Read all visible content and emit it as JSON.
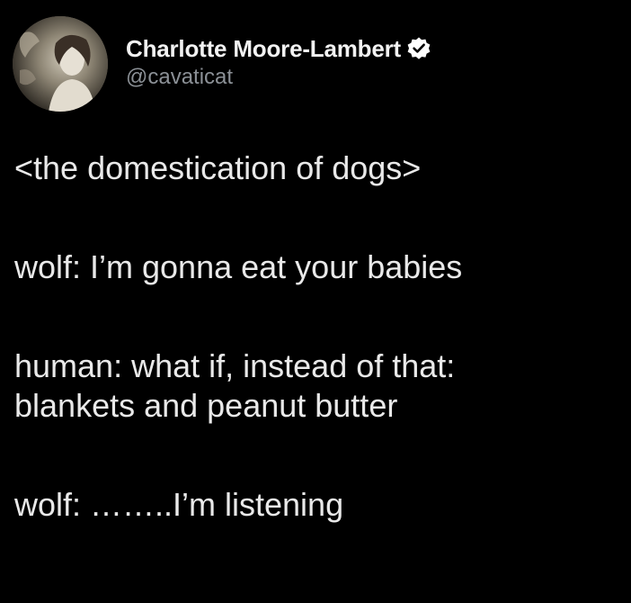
{
  "tweet": {
    "author": {
      "display_name": "Charlotte Moore-Lambert",
      "handle": "@cavaticat",
      "verified": true,
      "avatar_icon": "profile-avatar"
    },
    "lines": [
      "<the domestication of dogs>",
      "wolf: I’m gonna eat your babies",
      "human: what if, instead of that:",
      "blankets and peanut butter",
      "wolf: ……..I’m listening"
    ]
  },
  "colors": {
    "background": "#000000",
    "text": "#e9e9e9",
    "handle": "#8b9096",
    "verified_badge": "#ffffff"
  }
}
